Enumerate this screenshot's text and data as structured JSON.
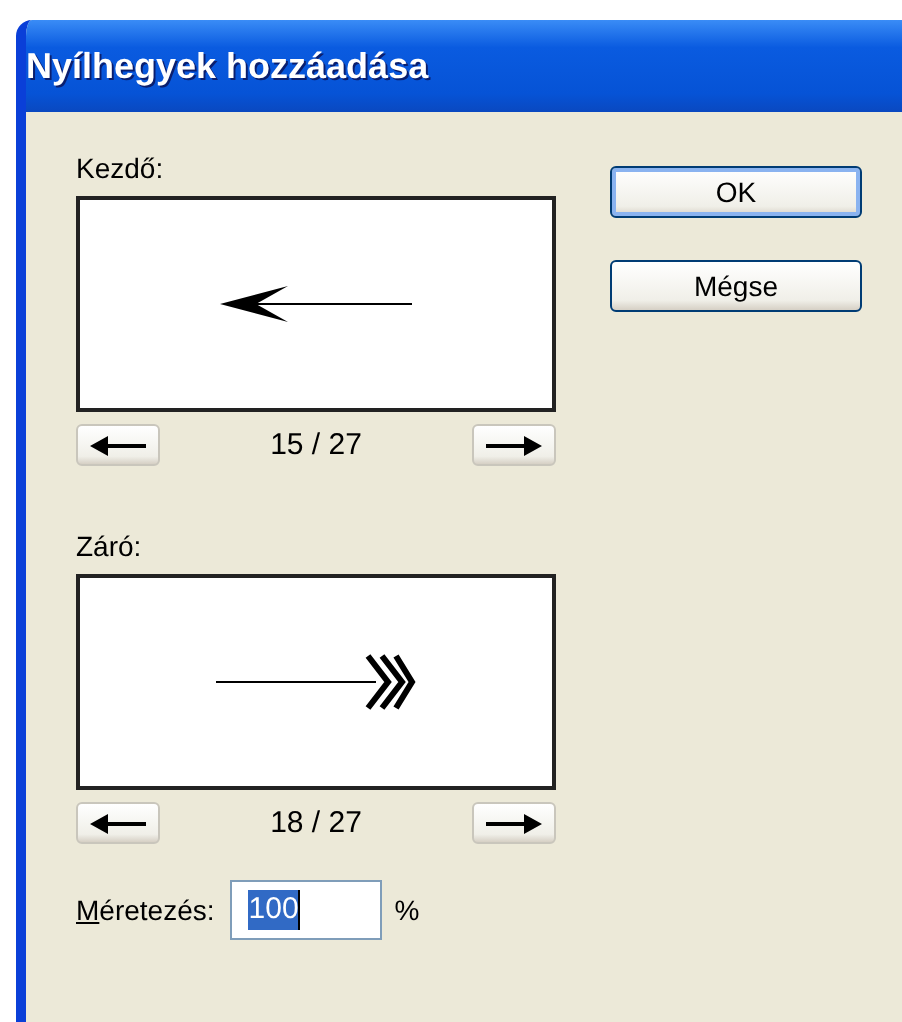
{
  "window": {
    "title": "Nyílhegyek hozzáadása"
  },
  "sections": [
    {
      "label": "Kezdő:",
      "kind": "start",
      "counter": "15 / 27"
    },
    {
      "label": "Záró:",
      "kind": "end",
      "counter": "18 / 27"
    }
  ],
  "buttons": [
    {
      "label": "OK",
      "default": true
    },
    {
      "label": "Mégse",
      "default": false
    }
  ],
  "scale": {
    "label": "Méretezés:",
    "first_letter_underlined": true,
    "value": "100",
    "selected": true,
    "unit": "%"
  }
}
